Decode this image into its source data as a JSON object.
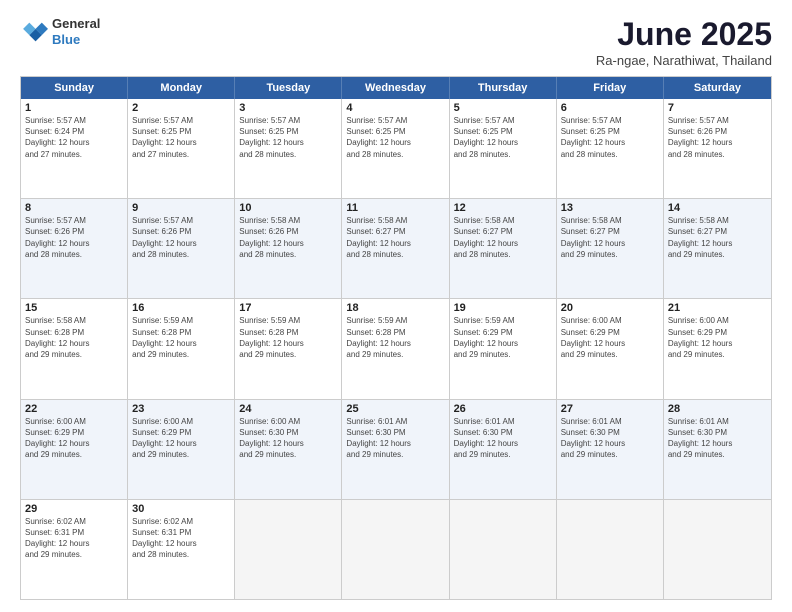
{
  "logo": {
    "line1": "General",
    "line2": "Blue"
  },
  "title": "June 2025",
  "subtitle": "Ra-ngae, Narathiwat, Thailand",
  "header_days": [
    "Sunday",
    "Monday",
    "Tuesday",
    "Wednesday",
    "Thursday",
    "Friday",
    "Saturday"
  ],
  "weeks": [
    {
      "alt": false,
      "cells": [
        {
          "day": "1",
          "info": "Sunrise: 5:57 AM\nSunset: 6:24 PM\nDaylight: 12 hours\nand 27 minutes."
        },
        {
          "day": "2",
          "info": "Sunrise: 5:57 AM\nSunset: 6:25 PM\nDaylight: 12 hours\nand 27 minutes."
        },
        {
          "day": "3",
          "info": "Sunrise: 5:57 AM\nSunset: 6:25 PM\nDaylight: 12 hours\nand 28 minutes."
        },
        {
          "day": "4",
          "info": "Sunrise: 5:57 AM\nSunset: 6:25 PM\nDaylight: 12 hours\nand 28 minutes."
        },
        {
          "day": "5",
          "info": "Sunrise: 5:57 AM\nSunset: 6:25 PM\nDaylight: 12 hours\nand 28 minutes."
        },
        {
          "day": "6",
          "info": "Sunrise: 5:57 AM\nSunset: 6:25 PM\nDaylight: 12 hours\nand 28 minutes."
        },
        {
          "day": "7",
          "info": "Sunrise: 5:57 AM\nSunset: 6:26 PM\nDaylight: 12 hours\nand 28 minutes."
        }
      ]
    },
    {
      "alt": true,
      "cells": [
        {
          "day": "8",
          "info": "Sunrise: 5:57 AM\nSunset: 6:26 PM\nDaylight: 12 hours\nand 28 minutes."
        },
        {
          "day": "9",
          "info": "Sunrise: 5:57 AM\nSunset: 6:26 PM\nDaylight: 12 hours\nand 28 minutes."
        },
        {
          "day": "10",
          "info": "Sunrise: 5:58 AM\nSunset: 6:26 PM\nDaylight: 12 hours\nand 28 minutes."
        },
        {
          "day": "11",
          "info": "Sunrise: 5:58 AM\nSunset: 6:27 PM\nDaylight: 12 hours\nand 28 minutes."
        },
        {
          "day": "12",
          "info": "Sunrise: 5:58 AM\nSunset: 6:27 PM\nDaylight: 12 hours\nand 28 minutes."
        },
        {
          "day": "13",
          "info": "Sunrise: 5:58 AM\nSunset: 6:27 PM\nDaylight: 12 hours\nand 29 minutes."
        },
        {
          "day": "14",
          "info": "Sunrise: 5:58 AM\nSunset: 6:27 PM\nDaylight: 12 hours\nand 29 minutes."
        }
      ]
    },
    {
      "alt": false,
      "cells": [
        {
          "day": "15",
          "info": "Sunrise: 5:58 AM\nSunset: 6:28 PM\nDaylight: 12 hours\nand 29 minutes."
        },
        {
          "day": "16",
          "info": "Sunrise: 5:59 AM\nSunset: 6:28 PM\nDaylight: 12 hours\nand 29 minutes."
        },
        {
          "day": "17",
          "info": "Sunrise: 5:59 AM\nSunset: 6:28 PM\nDaylight: 12 hours\nand 29 minutes."
        },
        {
          "day": "18",
          "info": "Sunrise: 5:59 AM\nSunset: 6:28 PM\nDaylight: 12 hours\nand 29 minutes."
        },
        {
          "day": "19",
          "info": "Sunrise: 5:59 AM\nSunset: 6:29 PM\nDaylight: 12 hours\nand 29 minutes."
        },
        {
          "day": "20",
          "info": "Sunrise: 6:00 AM\nSunset: 6:29 PM\nDaylight: 12 hours\nand 29 minutes."
        },
        {
          "day": "21",
          "info": "Sunrise: 6:00 AM\nSunset: 6:29 PM\nDaylight: 12 hours\nand 29 minutes."
        }
      ]
    },
    {
      "alt": true,
      "cells": [
        {
          "day": "22",
          "info": "Sunrise: 6:00 AM\nSunset: 6:29 PM\nDaylight: 12 hours\nand 29 minutes."
        },
        {
          "day": "23",
          "info": "Sunrise: 6:00 AM\nSunset: 6:29 PM\nDaylight: 12 hours\nand 29 minutes."
        },
        {
          "day": "24",
          "info": "Sunrise: 6:00 AM\nSunset: 6:30 PM\nDaylight: 12 hours\nand 29 minutes."
        },
        {
          "day": "25",
          "info": "Sunrise: 6:01 AM\nSunset: 6:30 PM\nDaylight: 12 hours\nand 29 minutes."
        },
        {
          "day": "26",
          "info": "Sunrise: 6:01 AM\nSunset: 6:30 PM\nDaylight: 12 hours\nand 29 minutes."
        },
        {
          "day": "27",
          "info": "Sunrise: 6:01 AM\nSunset: 6:30 PM\nDaylight: 12 hours\nand 29 minutes."
        },
        {
          "day": "28",
          "info": "Sunrise: 6:01 AM\nSunset: 6:30 PM\nDaylight: 12 hours\nand 29 minutes."
        }
      ]
    },
    {
      "alt": false,
      "cells": [
        {
          "day": "29",
          "info": "Sunrise: 6:02 AM\nSunset: 6:31 PM\nDaylight: 12 hours\nand 29 minutes."
        },
        {
          "day": "30",
          "info": "Sunrise: 6:02 AM\nSunset: 6:31 PM\nDaylight: 12 hours\nand 28 minutes."
        },
        {
          "day": "",
          "info": ""
        },
        {
          "day": "",
          "info": ""
        },
        {
          "day": "",
          "info": ""
        },
        {
          "day": "",
          "info": ""
        },
        {
          "day": "",
          "info": ""
        }
      ]
    }
  ]
}
